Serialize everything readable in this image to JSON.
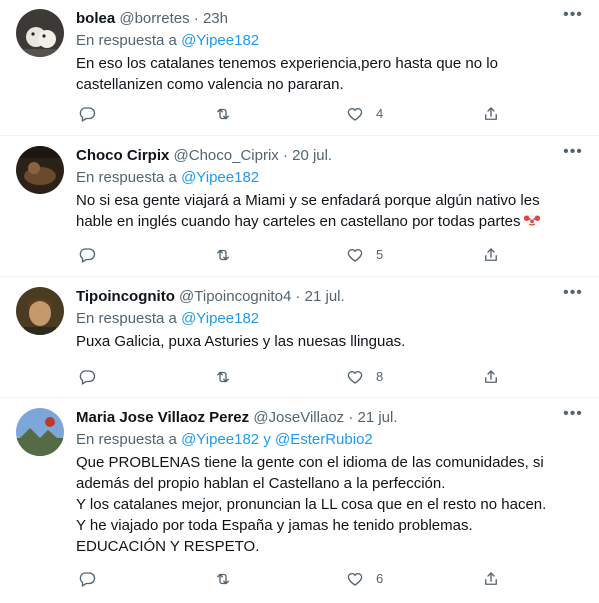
{
  "tweets": [
    {
      "name": "bolea",
      "handle": "@borretes",
      "separator": "·",
      "time": "23h",
      "reply_prefix": "En respuesta a",
      "mention1": "@Yipee182",
      "lines": [
        "En eso los catalanes tenemos experiencia,pero hasta que no lo",
        "castellanizen como valencia no pararan."
      ],
      "likes": "4"
    },
    {
      "name": "Choco Cirpix",
      "handle": "@Choco_Ciprix",
      "separator": "·",
      "time": "20 jul.",
      "reply_prefix": "En respuesta a",
      "mention1": "@Yipee182",
      "lines": [
        "No si esa gente viajará a Miami y se enfadará porque algún nativo les",
        "hable en inglés cuando hay carteles en castellano por todas partes"
      ],
      "emoji": "clown-face-emoji",
      "likes": "5"
    },
    {
      "name": "Tipoincognito",
      "handle": "@Tipoincognito4",
      "separator": "·",
      "time": "21 jul.",
      "reply_prefix": "En respuesta a",
      "mention1": "@Yipee182",
      "lines": [
        "Puxa Galicia, puxa Asturies y las nuesas llinguas."
      ],
      "likes": "8"
    },
    {
      "name": "Maria Jose Villaoz Perez",
      "handle": "@JoseVillaoz",
      "separator": "·",
      "time": "21 jul.",
      "reply_prefix": "En respuesta a",
      "mention1": "@Yipee182",
      "conjunction": "y",
      "mention2": "@EsterRubio2",
      "lines": [
        "Que PROBLENAS tiene la gente con el idioma de las  comunidades, si",
        "además del propio hablan el Castellano a la perfección.",
        "Y los catalanes mejor, pronuncian la LL cosa que en el resto no hacen.",
        "Y he viajado por toda España y jamas he tenido problemas.",
        "EDUCACIÓN Y RESPETO."
      ],
      "likes": "6"
    }
  ],
  "icons": {
    "more": "more-horizontal-icon",
    "reply": "reply-icon",
    "retweet": "retweet-icon",
    "like": "heart-icon",
    "share": "share-icon"
  },
  "colors": {
    "link": "#1d9bf0",
    "secondary": "#536471",
    "text": "#0f1419",
    "divider": "#eff3f4"
  }
}
